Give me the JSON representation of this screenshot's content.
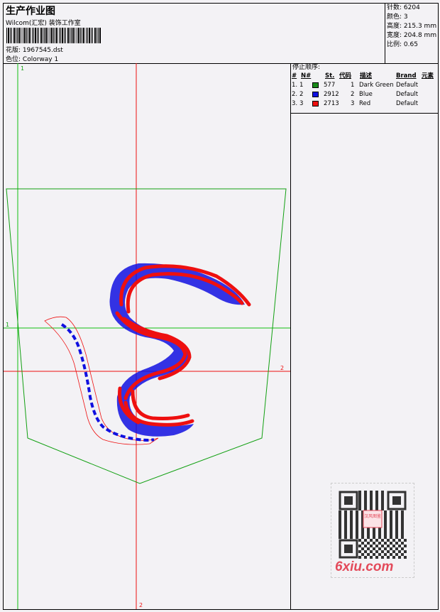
{
  "header": {
    "title": "生产作业图",
    "company": "Wilcom(汇宏) 装饰工作室",
    "design_label": "花版:",
    "design_file": "1967545.dst",
    "colorway_label": "色位:",
    "colorway_value": "Colorway 1"
  },
  "stats": {
    "stitches_label": "针数:",
    "stitches": "6204",
    "colors_label": "颜色:",
    "colors": "3",
    "height_label": "高度:",
    "height": "215.3 mm",
    "width_label": "宽度:",
    "width": "204.8 mm",
    "scale_label": "比例:",
    "scale": "0.65"
  },
  "stop_sequence": {
    "title": "停止顺序:",
    "columns": [
      "#",
      "N#",
      "St.",
      "代码",
      "描述",
      "Brand",
      "元素"
    ],
    "rows": [
      {
        "idx": "1.",
        "n": "1",
        "color": "#1a8a1a",
        "st": "577",
        "code": "1",
        "desc": "Dark Green",
        "brand": "Default"
      },
      {
        "idx": "2.",
        "n": "2",
        "color": "#1010e0",
        "st": "2912",
        "code": "2",
        "desc": "Blue",
        "brand": "Default"
      },
      {
        "idx": "3.",
        "n": "3",
        "color": "#ee1010",
        "st": "2713",
        "code": "3",
        "desc": "Red",
        "brand": "Default"
      }
    ]
  },
  "canvas": {
    "guide_labels": {
      "v1": "1",
      "h1": "1",
      "h2": "2",
      "v2": "2"
    },
    "colors": {
      "green": "#11a011",
      "red": "#ee1010",
      "blue": "#1010e0"
    }
  },
  "watermark": {
    "text": "6xiu.com",
    "qr_text": "汉风图鉴"
  }
}
